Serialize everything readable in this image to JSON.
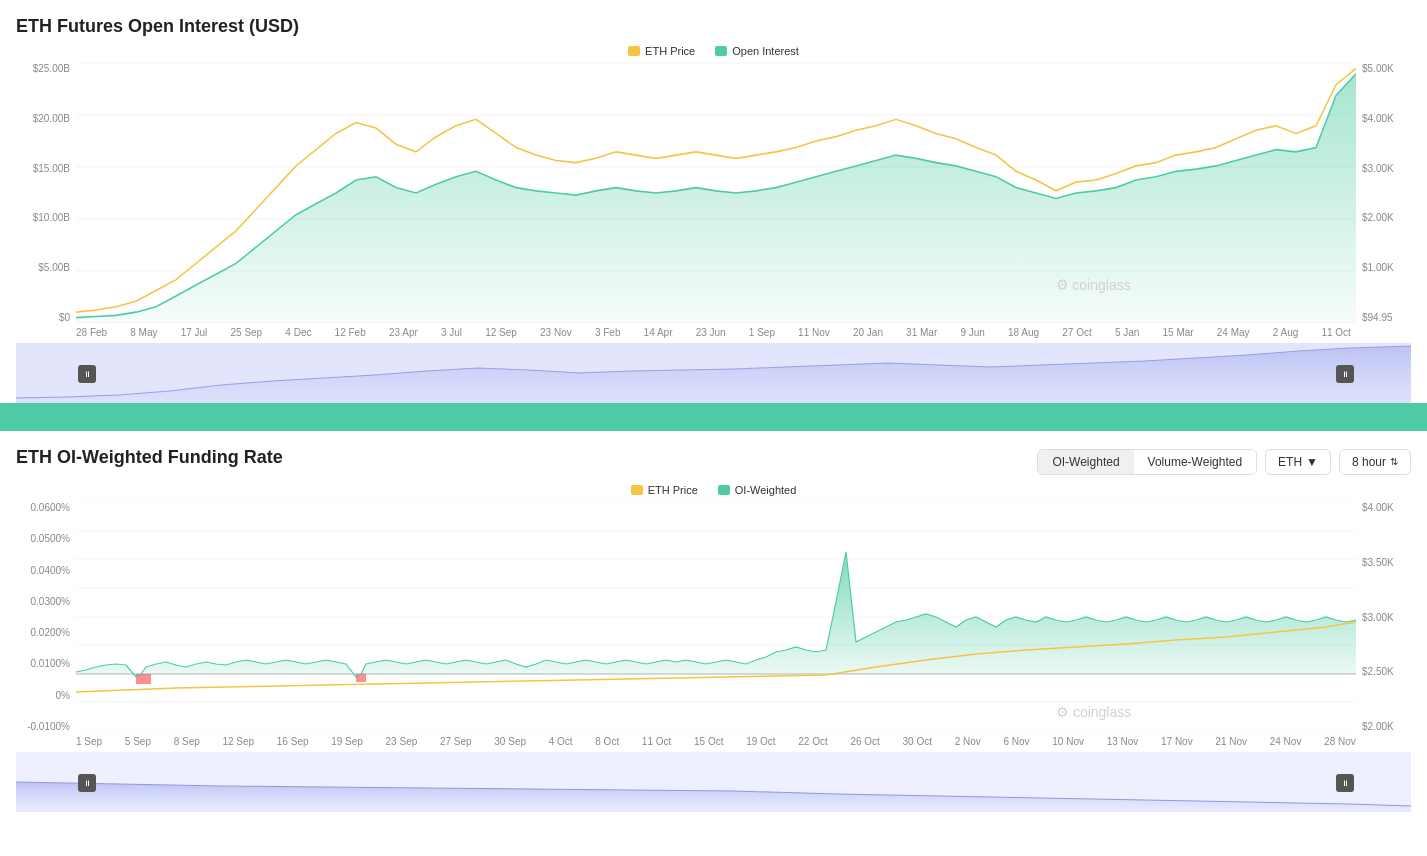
{
  "chart1": {
    "title": "ETH Futures Open Interest (USD)",
    "legend": {
      "eth_price_label": "ETH Price",
      "open_interest_label": "Open Interest",
      "eth_price_color": "#F5C444",
      "open_interest_color": "#4ECBA5"
    },
    "y_axis_left": [
      "$25.00B",
      "$20.00B",
      "$15.00B",
      "$10.00B",
      "$5.00B",
      "$0"
    ],
    "y_axis_right": [
      "$5.00K",
      "$4.00K",
      "$3.00K",
      "$2.00K",
      "$1.00K",
      "$94.95"
    ],
    "x_axis": [
      "28 Feb",
      "8 May",
      "17 Jul",
      "25 Sep",
      "4 Dec",
      "12 Feb",
      "23 Apr",
      "3 Jul",
      "12 Sep",
      "23 Nov",
      "3 Feb",
      "14 Apr",
      "23 Jun",
      "1 Sep",
      "11 Nov",
      "20 Jan",
      "31 Mar",
      "9 Jun",
      "18 Aug",
      "27 Oct",
      "5 Jan",
      "15 Mar",
      "24 May",
      "2 Aug",
      "11 Oct"
    ],
    "watermark": "coinglass"
  },
  "chart2": {
    "title": "ETH OI-Weighted Funding Rate",
    "legend": {
      "eth_price_label": "ETH Price",
      "oi_weighted_label": "OI-Weighted",
      "eth_price_color": "#F5C444",
      "oi_weighted_color": "#4ECBA5"
    },
    "controls": {
      "oi_weighted": "OI-Weighted",
      "volume_weighted": "Volume-Weighted",
      "asset": "ETH",
      "interval": "8 hour"
    },
    "y_axis_left": [
      "0.0600%",
      "0.0500%",
      "0.0400%",
      "0.0300%",
      "0.0200%",
      "0.0100%",
      "0%",
      "-0.0100%"
    ],
    "y_axis_right": [
      "$4.00K",
      "$3.50K",
      "$3.00K",
      "$2.50K",
      "$2.00K"
    ],
    "x_axis": [
      "1 Sep",
      "5 Sep",
      "8 Sep",
      "12 Sep",
      "16 Sep",
      "19 Sep",
      "23 Sep",
      "27 Sep",
      "30 Sep",
      "4 Oct",
      "8 Oct",
      "11 Oct",
      "15 Oct",
      "19 Oct",
      "22 Oct",
      "26 Oct",
      "30 Oct",
      "2 Nov",
      "6 Nov",
      "10 Nov",
      "13 Nov",
      "17 Nov",
      "21 Nov",
      "24 Nov",
      "28 Nov"
    ],
    "watermark": "coinglass"
  }
}
